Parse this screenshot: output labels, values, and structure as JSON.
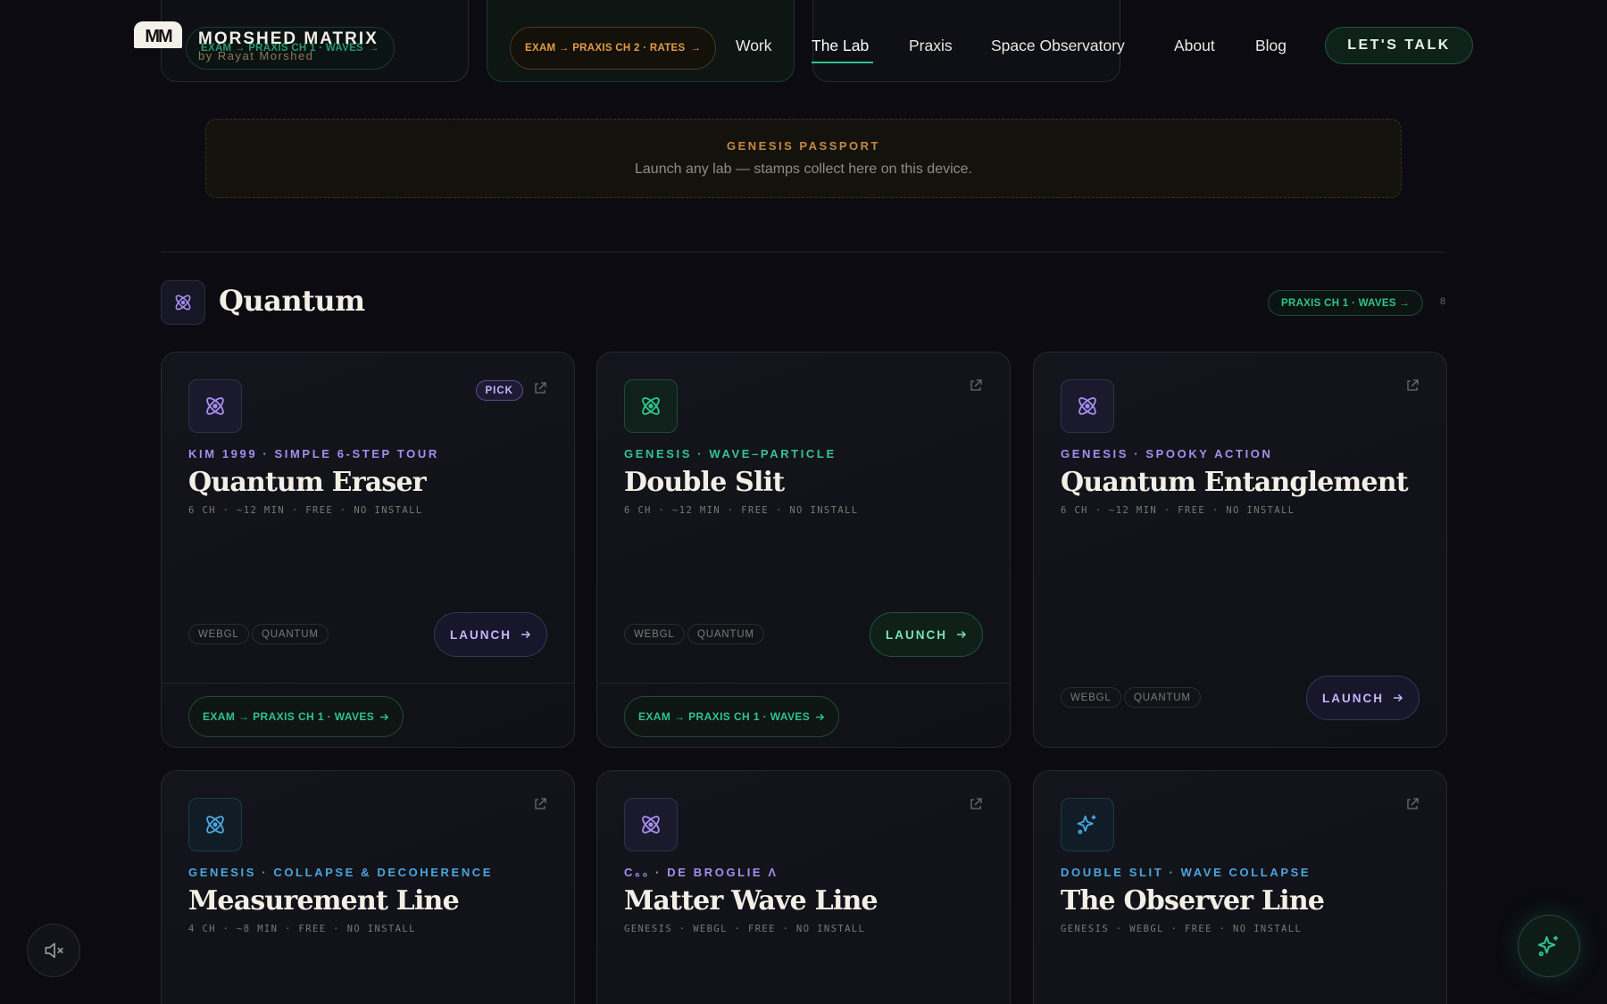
{
  "top_pills": [
    {
      "label": "EXAM → PRAXIS CH 1 · WAVES",
      "arrow": "→"
    },
    {
      "label": "EXAM → PRAXIS CH 2 · RATES",
      "arrow": "→"
    }
  ],
  "brand": {
    "logo": "MM",
    "name": "MORSHED MATRIX",
    "byline": "by Rayat Morshed"
  },
  "nav": {
    "items": [
      "Work",
      "The Lab",
      "Praxis",
      "Space Observatory",
      "About",
      "Blog"
    ],
    "active": "The Lab",
    "cta": "LET'S TALK"
  },
  "passport": {
    "title": "GENESIS PASSPORT",
    "text": "Launch any lab — stamps collect here on this device."
  },
  "section": {
    "icon": "atom-icon",
    "title": "Quantum",
    "link": "PRAXIS CH 1 · WAVES →",
    "count": "8"
  },
  "cards": [
    {
      "icon": "atom-icon",
      "accent": "purple",
      "pick": "PICK",
      "eyebrow": "KIM 1999 · SIMPLE 6-STEP TOUR",
      "title": "Quantum Eraser",
      "meta": "6 CH · ~12 MIN · FREE · NO INSTALL",
      "tags": [
        "WEBGL",
        "QUANTUM"
      ],
      "launch": "LAUNCH",
      "footer": "EXAM → PRAXIS CH 1 · WAVES"
    },
    {
      "icon": "atom-icon",
      "accent": "green",
      "eyebrow": "GENESIS · WAVE–PARTICLE",
      "title": "Double Slit",
      "meta": "6 CH · ~12 MIN · FREE · NO INSTALL",
      "tags": [
        "WEBGL",
        "QUANTUM"
      ],
      "launch": "LAUNCH",
      "footer": "EXAM → PRAXIS CH 1 · WAVES"
    },
    {
      "icon": "atom-icon",
      "accent": "purple",
      "eyebrow": "GENESIS · SPOOKY ACTION",
      "title": "Quantum Entanglement",
      "meta": "6 CH · ~12 MIN · FREE · NO INSTALL",
      "tags": [
        "WEBGL",
        "QUANTUM"
      ],
      "launch": "LAUNCH"
    },
    {
      "icon": "atom-icon",
      "accent": "blue",
      "eyebrow": "GENESIS · COLLAPSE & DECOHERENCE",
      "title": "Measurement Line",
      "meta": "4 CH · ~8 MIN · FREE · NO INSTALL"
    },
    {
      "icon": "atom-icon",
      "accent": "purple",
      "eyebrow": "C₆₀ · DE BROGLIE Λ",
      "title": "Matter Wave Line",
      "meta": "GENESIS · WEBGL · FREE · NO INSTALL"
    },
    {
      "icon": "sparkle-icon",
      "accent": "blue",
      "eyebrow": "DOUBLE SLIT · WAVE COLLAPSE",
      "title": "The Observer Line",
      "meta": "GENESIS · WEBGL · FREE · NO INSTALL"
    }
  ],
  "floating": {
    "sound": "mute-icon",
    "assistant": "sparkle-icon"
  },
  "colors": {
    "bg": "#0b0b11",
    "green": "#2fc48d",
    "purple": "#a48ef0",
    "blue": "#4aa6de",
    "orange": "#e79a45"
  }
}
